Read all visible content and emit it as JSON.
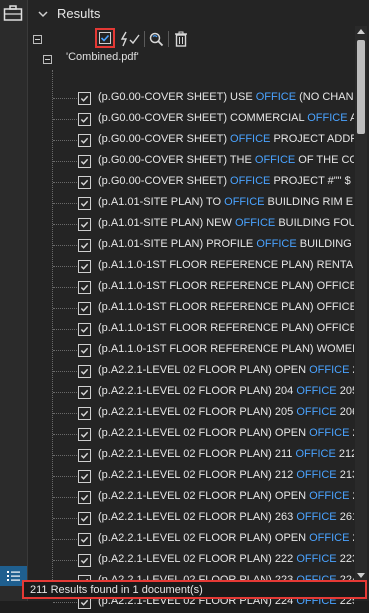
{
  "panel": {
    "title": "Results",
    "file_name": "'Combined.pdf'"
  },
  "toolbar": {
    "check_all": "check-all-icon",
    "quick_actions": "lightning-check-icon",
    "zoom": "zoom-refresh-icon",
    "delete": "trash-icon"
  },
  "colors": {
    "accent_blue": "#4aa3ff",
    "highlight_red": "#e53935",
    "background": "#242424"
  },
  "results": [
    {
      "pre": "(p.G0.00-COVER SHEET) USE ",
      "hl": "OFFICE",
      "post": " (NO CHANGE P..."
    },
    {
      "pre": "(p.G0.00-COVER SHEET) COMMERCIAL ",
      "hl": "OFFICE",
      "post": " ACCE..."
    },
    {
      "pre": "(p.G0.00-COVER SHEET) ",
      "hl": "OFFICE",
      "post": " PROJECT ADDRESS ..."
    },
    {
      "pre": "(p.G0.00-COVER SHEET) THE ",
      "hl": "OFFICE",
      "post": " OF THE COUNT..."
    },
    {
      "pre": "(p.G0.00-COVER SHEET)  ",
      "hl": "OFFICE",
      "post": " PROJECT #\"\" $"
    },
    {
      "pre": "(p.A1.01-SITE PLAN) TO ",
      "hl": "OFFICE",
      "post": " BUILDING RIM ELEV ..."
    },
    {
      "pre": "(p.A1.01-SITE PLAN) NEW ",
      "hl": "OFFICE",
      "post": " BUILDING FOUNTA..."
    },
    {
      "pre": "(p.A1.01-SITE PLAN) PROFILE ",
      "hl": "OFFICE",
      "post": " BUILDING Proje..."
    },
    {
      "pre": "(p.A1.1.0-1ST FLOOR REFERENCE PLAN) RENTAL ",
      "hl": "OF...",
      "post": ""
    },
    {
      "pre": "(p.A1.1.0-1ST FLOOR REFERENCE PLAN) OFFICE",
      "hl": "OFFI...",
      "post": ""
    },
    {
      "pre": "(p.A1.1.0-1ST FLOOR REFERENCE PLAN) OFFICE",
      "hl": "OFFI...",
      "post": ""
    },
    {
      "pre": "(p.A1.1.0-1ST FLOOR REFERENCE PLAN) OFFICE",
      "hl": "OFFI...",
      "post": ""
    },
    {
      "pre": "(p.A1.1.0-1ST FLOOR REFERENCE PLAN) WOMEN ",
      "hl": "OF...",
      "post": ""
    },
    {
      "pre": "(p.A2.2.1-LEVEL 02 FLOOR PLAN) OPEN ",
      "hl": "OFFICE",
      "post": "  200..."
    },
    {
      "pre": "(p.A2.2.1-LEVEL 02 FLOOR PLAN) 204 ",
      "hl": "OFFICE",
      "post": "  205 O..."
    },
    {
      "pre": "(p.A2.2.1-LEVEL 02 FLOOR PLAN) 205 ",
      "hl": "OFFICE",
      "post": "  206 O..."
    },
    {
      "pre": "(p.A2.2.1-LEVEL 02 FLOOR PLAN) OPEN ",
      "hl": "OFFICE",
      "post": "  248..."
    },
    {
      "pre": "(p.A2.2.1-LEVEL 02 FLOOR PLAN) 211 ",
      "hl": "OFFICE",
      "post": "  212 O..."
    },
    {
      "pre": "(p.A2.2.1-LEVEL 02 FLOOR PLAN) 212 ",
      "hl": "OFFICE",
      "post": "  213 M..."
    },
    {
      "pre": "(p.A2.2.1-LEVEL 02 FLOOR PLAN) OPEN ",
      "hl": "OFFICE",
      "post": "  263..."
    },
    {
      "pre": "(p.A2.2.1-LEVEL 02 FLOOR PLAN) 263 ",
      "hl": "OFFICE",
      "post": "  261 C..."
    },
    {
      "pre": "(p.A2.2.1-LEVEL 02 FLOOR PLAN) OPEN ",
      "hl": "OFFICE",
      "post": "  222..."
    },
    {
      "pre": "(p.A2.2.1-LEVEL 02 FLOOR PLAN) 222 ",
      "hl": "OFFICE",
      "post": "  223 O..."
    },
    {
      "pre": "(p.A2.2.1-LEVEL 02 FLOOR PLAN) 223 ",
      "hl": "OFFICE",
      "post": "  224 O..."
    },
    {
      "pre": "(p.A2.2.1-LEVEL 02 FLOOR PLAN) 224 ",
      "hl": "OFFICE",
      "post": "  225 O..."
    }
  ],
  "status": {
    "text": "211 Results found in 1 document(s)"
  }
}
